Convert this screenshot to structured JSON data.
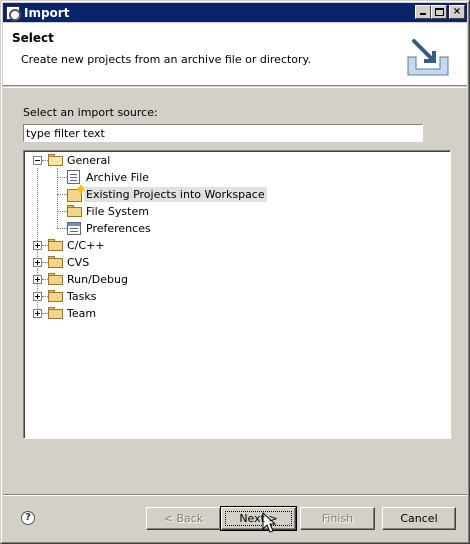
{
  "window": {
    "title": "Import",
    "icon": "eclipse-import-icon"
  },
  "header": {
    "title": "Select",
    "description": "Create new projects from an archive file or directory.",
    "graphic": "import-wizard-icon"
  },
  "source": {
    "label": "Select an import source:",
    "filter_value": "type filter text",
    "filter_placeholder": "type filter text"
  },
  "tree": {
    "items": [
      {
        "label": "General",
        "expanded": true,
        "icon": "folder-open-icon"
      },
      {
        "label": "Archive File",
        "icon": "archive-file-icon"
      },
      {
        "label": "Existing Projects into Workspace",
        "icon": "project-icon",
        "selected": true
      },
      {
        "label": "File System",
        "icon": "folder-icon"
      },
      {
        "label": "Preferences",
        "icon": "preferences-icon"
      },
      {
        "label": "C/C++",
        "expanded": false,
        "icon": "folder-icon"
      },
      {
        "label": "CVS",
        "expanded": false,
        "icon": "folder-icon"
      },
      {
        "label": "Run/Debug",
        "expanded": false,
        "icon": "folder-icon"
      },
      {
        "label": "Tasks",
        "expanded": false,
        "icon": "folder-icon"
      },
      {
        "label": "Team",
        "expanded": false,
        "icon": "folder-icon"
      }
    ]
  },
  "buttons": {
    "back": "< Back",
    "next": "Next >",
    "finish": "Finish",
    "cancel": "Cancel"
  },
  "colors": {
    "titlebar": "#0a246a",
    "dialog_bg": "#d4d0c8",
    "selection": "#e1e1e1"
  }
}
